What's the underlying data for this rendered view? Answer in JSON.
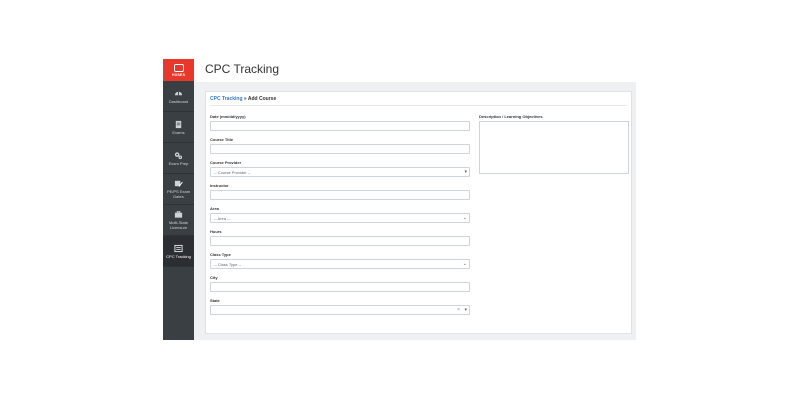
{
  "sidebar": {
    "logo_text": "HOSES",
    "items": [
      {
        "label": "Dashboard",
        "icon": "dashboard-icon"
      },
      {
        "label": "Exams",
        "icon": "clipboard-icon"
      },
      {
        "label": "Exam Prep",
        "icon": "gears-icon"
      },
      {
        "label": "PE/PS Exam Dates",
        "icon": "calendar-edit-icon"
      },
      {
        "label": "Multi-State Licensure",
        "icon": "briefcase-icon"
      },
      {
        "label": "CPC Tracking",
        "icon": "list-icon"
      }
    ]
  },
  "page": {
    "title": "CPC Tracking"
  },
  "breadcrumb": {
    "link": "CPC Tracking",
    "separator": " » ",
    "current": "Add Course"
  },
  "form": {
    "date_label": "Date (mm/dd/yyyy)",
    "course_title_label": "Course Title",
    "course_provider_label": "Course Provider",
    "course_provider_value": "-- Course Provider --",
    "instructor_label": "Instructor",
    "area_label": "Area",
    "area_value": "-- Area --",
    "hours_label": "Hours",
    "class_type_label": "Class Type",
    "class_type_value": "-- Class Type --",
    "city_label": "City",
    "state_label": "State",
    "description_label": "Description / Learning Objectives"
  },
  "colors": {
    "accent": "#e8372b",
    "sidebar": "#3a3f44",
    "link": "#3a7bbf"
  }
}
